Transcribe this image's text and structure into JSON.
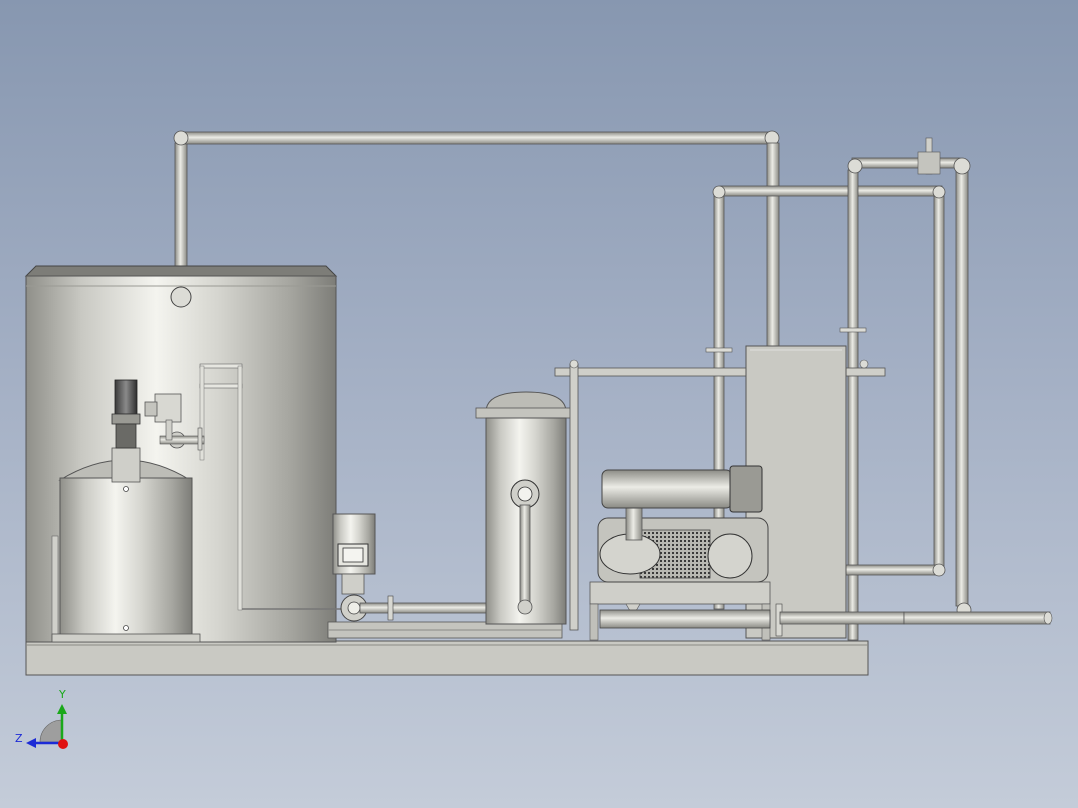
{
  "view": {
    "background_top": "#8797b0",
    "background_bottom": "#c4ccd9"
  },
  "triad": {
    "y_label": "Y",
    "z_label": "Z",
    "y_color": "#1aa81a",
    "z_color": "#1c2bd6",
    "x_color": "#e01010"
  }
}
